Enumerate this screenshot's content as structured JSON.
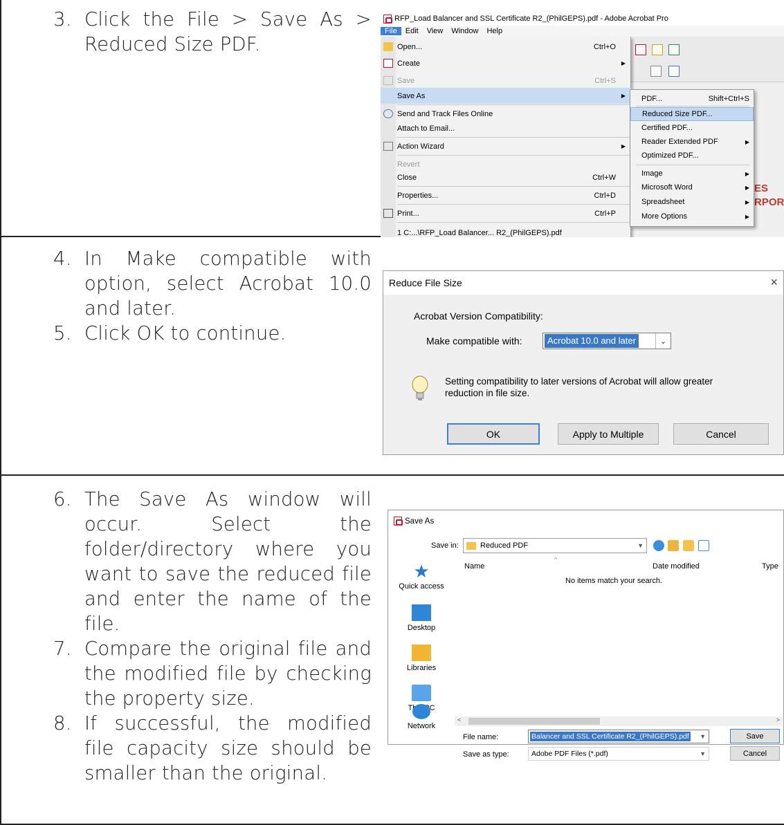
{
  "steps": [
    {
      "num": "3.",
      "text": "Click the File > Save As > Reduced Size PDF."
    },
    {
      "num": "4.",
      "text": "In Make compatible with option, select Acrobat 10.0 and later."
    },
    {
      "num": "5.",
      "text": "Click OK to continue."
    },
    {
      "num": "6.",
      "text": "The Save As window will occur. Select the folder/directory where you want to save the reduced file and enter the name of the file."
    },
    {
      "num": "7.",
      "text": "Compare the original file and the modified file by checking the property size."
    },
    {
      "num": "8.",
      "text": "If successful, the modified file capacity size should be smaller than the original."
    }
  ],
  "acrobat": {
    "window_title": "RFP_Load Balancer and SSL Certificate R2_(PhilGEPS).pdf - Adobe Acrobat Pro",
    "menubar": [
      "File",
      "Edit",
      "View",
      "Window",
      "Help"
    ],
    "file_menu": [
      {
        "label": "Open...",
        "shortcut": "Ctrl+O"
      },
      {
        "label": "Create",
        "shortcut": ""
      },
      {
        "label": "Save",
        "shortcut": "Ctrl+S"
      },
      {
        "label": "Save As",
        "shortcut": ""
      },
      {
        "label": "Send and Track Files Online",
        "shortcut": ""
      },
      {
        "label": "Attach to Email...",
        "shortcut": ""
      },
      {
        "label": "Action Wizard",
        "shortcut": ""
      },
      {
        "label": "Revert",
        "shortcut": ""
      },
      {
        "label": "Close",
        "shortcut": "Ctrl+W"
      },
      {
        "label": "Properties...",
        "shortcut": "Ctrl+D"
      },
      {
        "label": "Print...",
        "shortcut": "Ctrl+P"
      },
      {
        "label": "1 C:...\\RFP_Load Balancer... R2_(PhilGEPS).pdf",
        "shortcut": ""
      }
    ],
    "save_as_submenu": [
      {
        "label": "PDF...",
        "shortcut": "Shift+Ctrl+S"
      },
      {
        "label": "Reduced Size PDF...",
        "shortcut": ""
      },
      {
        "label": "Certified PDF...",
        "shortcut": ""
      },
      {
        "label": "Reader Extended PDF",
        "shortcut": ""
      },
      {
        "label": "Optimized PDF...",
        "shortcut": ""
      },
      {
        "label": "Image",
        "shortcut": ""
      },
      {
        "label": "Microsoft Word",
        "shortcut": ""
      },
      {
        "label": "Spreadsheet",
        "shortcut": ""
      },
      {
        "label": "More Options",
        "shortcut": ""
      }
    ],
    "background_text": [
      "ES",
      "RPOR"
    ]
  },
  "reduce_dialog": {
    "title": "Reduce File Size",
    "close": "×",
    "group_label": "Acrobat Version Compatibility:",
    "make_label": "Make compatible with:",
    "selected_value": "Acrobat 10.0 and later",
    "note": "Setting compatibility to later versions of Acrobat will allow greater reduction in file size.",
    "buttons": {
      "ok": "OK",
      "multiple": "Apply to Multiple",
      "cancel": "Cancel"
    }
  },
  "save_dialog": {
    "title": "Save As",
    "save_in_label": "Save in:",
    "save_in_value": "Reduced PDF",
    "sidebar": [
      "Quick access",
      "Desktop",
      "Libraries",
      "This PC",
      "Network"
    ],
    "columns": {
      "name": "Name",
      "date": "Date modified",
      "type": "Type"
    },
    "empty_message": "No items match your search.",
    "file_name_label": "File name:",
    "file_name_value": "Balancer and SSL Certificate R2_(PhilGEPS).pdf",
    "save_type_label": "Save as type:",
    "save_type_value": "Adobe PDF Files (*.pdf)",
    "buttons": {
      "save": "Save",
      "cancel": "Cancel"
    }
  },
  "colors": {
    "highlight": "#3b78c4",
    "menu_hover": "#c7dbf2",
    "pdf_red": "#c8102e",
    "folder": "#f3c34e"
  }
}
